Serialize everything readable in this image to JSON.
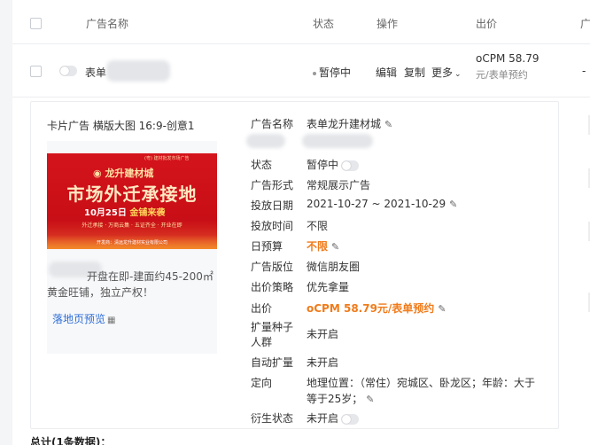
{
  "header": {
    "col_name": "广告名称",
    "col_status": "状态",
    "col_action": "操作",
    "col_bid": "出价",
    "col_more": "广"
  },
  "row": {
    "name_prefix": "表单",
    "status": "暂停中",
    "action_edit": "编辑",
    "action_copy": "复制",
    "action_more": "更多",
    "bid_value": "oCPM 58.79",
    "bid_unit": "元/表单预约",
    "more_dash": "-"
  },
  "detail": {
    "creative_title": "卡片广告 横版大图 16:9-创意1",
    "banner": {
      "small_text": "(粤) 建材批发市场广告",
      "logo_text": "龙升建材城",
      "headline": "市场外迁承接地",
      "date_text": "10月25日",
      "date_highlight": "金铺来袭",
      "sub_text": "外迁承接 · 万商云集 · 五证齐全 · 开业在即",
      "footer_text": "开发商：清远龙升建材实业有限公司"
    },
    "description": "开盘在即-建面约45-200㎡黄金旺铺，独立产权！",
    "landing_link": "落地页预览",
    "fields": {
      "name_label": "广告名称",
      "name_value": "表单龙升建材城",
      "status_label": "状态",
      "status_value": "暂停中",
      "form_label": "广告形式",
      "form_value": "常规展示广告",
      "date_label": "投放日期",
      "date_value": "2021-10-27 ~ 2021-10-29",
      "time_label": "投放时间",
      "time_value": "不限",
      "budget_label": "日预算",
      "budget_value": "不限",
      "slot_label": "广告版位",
      "slot_value": "微信朋友圈",
      "strategy_label": "出价策略",
      "strategy_value": "优先拿量",
      "bid_label": "出价",
      "bid_value": "oCPM 58.79元/表单预约",
      "seed_label_1": "扩量种子",
      "seed_label_2": "人群",
      "seed_value": "未开启",
      "auto_label": "自动扩量",
      "auto_value": "未开启",
      "target_label": "定向",
      "target_value_1": "地理位置：（常住）宛城区、卧龙区；年龄：大于",
      "target_value_2": "等于25岁；",
      "derived_label": "衍生状态",
      "derived_value": "未开启"
    }
  },
  "footer": {
    "total": "总计(1条数据)："
  },
  "colors": {
    "accent_orange": "#f07b1a",
    "link_blue": "#2f6fd6",
    "banner_red": "#d4141c"
  }
}
